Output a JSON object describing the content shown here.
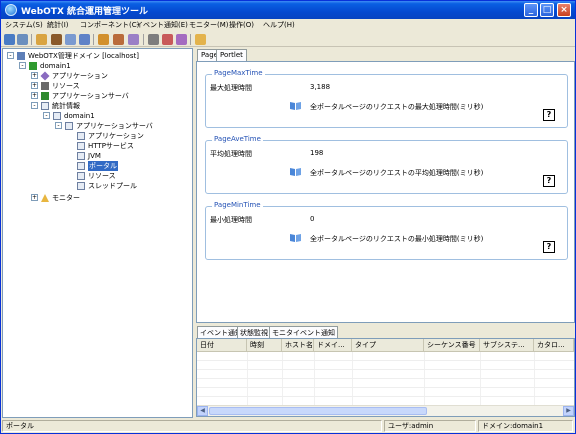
{
  "window": {
    "title": "WebOTX 統合運用管理ツール"
  },
  "menu": [
    "システム(S)",
    "統計(I)",
    "コンポーネント(C)",
    "イベント通知(E)",
    "モニター(M)",
    "操作(O)",
    "ヘルプ(H)"
  ],
  "toolbar": {
    "icons": [
      "connect-icon",
      "disconnect-icon",
      "properties-icon",
      "pin-icon",
      "find-icon",
      "refresh-icon",
      "flag-icon",
      "tools-icon",
      "wrench-icon",
      "print-icon",
      "chart-icon",
      "chart2-icon",
      "folder-icon"
    ]
  },
  "tree": [
    {
      "label": "WebOTX管理ドメイン [localhost]",
      "level": 0,
      "toggle": "-",
      "icon": "computer-icon"
    },
    {
      "label": "domain1",
      "level": 1,
      "toggle": "-",
      "icon": "domain-icon"
    },
    {
      "label": "アプリケーション",
      "level": 2,
      "toggle": "+",
      "icon": "diamond-icon"
    },
    {
      "label": "リソース",
      "level": 2,
      "toggle": "+",
      "icon": "resource-icon"
    },
    {
      "label": "アプリケーションサーバ",
      "level": 2,
      "toggle": "+",
      "icon": "server-icon"
    },
    {
      "label": "統計情報",
      "level": 2,
      "toggle": "-",
      "icon": "stats-icon"
    },
    {
      "label": "domain1",
      "level": 3,
      "toggle": "-",
      "icon": "stats-icon"
    },
    {
      "label": "アプリケーションサーバ",
      "level": 4,
      "toggle": "-",
      "icon": "stats-icon"
    },
    {
      "label": "アプリケーション",
      "level": 5,
      "toggle": "",
      "icon": "stats-icon"
    },
    {
      "label": "HTTPサービス",
      "level": 5,
      "toggle": "",
      "icon": "stats-icon"
    },
    {
      "label": "JVM",
      "level": 5,
      "toggle": "",
      "icon": "stats-icon"
    },
    {
      "label": "ポータル",
      "level": 5,
      "toggle": "",
      "icon": "stats-icon",
      "selected": true
    },
    {
      "label": "リソース",
      "level": 5,
      "toggle": "",
      "icon": "stats-icon"
    },
    {
      "label": "スレッドプール",
      "level": 5,
      "toggle": "",
      "icon": "stats-icon"
    },
    {
      "label": "モニター",
      "level": 1,
      "toggle": "+",
      "icon": "monitor-icon"
    }
  ],
  "tabs_top": [
    "Page",
    "Portlet"
  ],
  "groups": [
    {
      "title": "PageMaxTime",
      "label": "最大処理時間",
      "value": "3,188",
      "desc": "全ポータルページのリクエストの最大処理時間(ミリ秒)",
      "help": "?"
    },
    {
      "title": "PageAveTime",
      "label": "平均処理時間",
      "value": "198",
      "desc": "全ポータルページのリクエストの平均処理時間(ミリ秒)",
      "help": "?"
    },
    {
      "title": "PageMinTime",
      "label": "最小処理時間",
      "value": "0",
      "desc": "全ポータルページのリクエストの最小処理時間(ミリ秒)",
      "help": "?"
    }
  ],
  "tabs_bottom": [
    "イベント通知",
    "状態監視",
    "モニタイベント通知"
  ],
  "event_columns": [
    "日付",
    "時刻",
    "ホスト名",
    "ドメイ...",
    "タイプ",
    "シーケンス番号",
    "サブシステ...",
    "カタロ..."
  ],
  "status": {
    "left": "ポータル",
    "user": "ユーザ:admin",
    "domain": "ドメイン:domain1"
  },
  "colors": {
    "title_bar": "#0449d0",
    "selection": "#316ac5",
    "group_title": "#2452b5"
  }
}
